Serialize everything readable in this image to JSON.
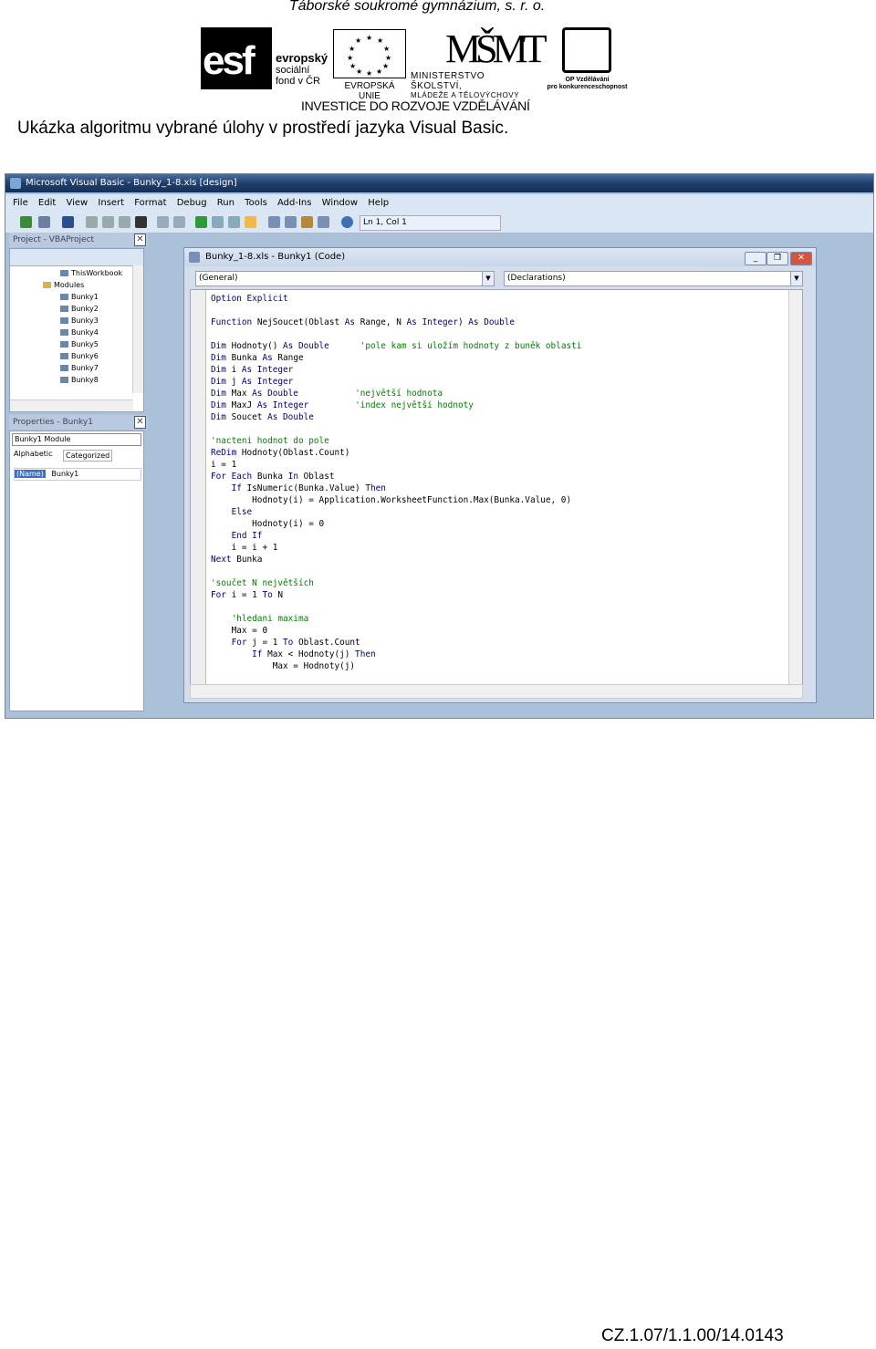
{
  "header": {
    "school": "Táborské soukromé gymnázium, s. r. o.",
    "logos": {
      "esf_letters": "esf",
      "esf_line1": "evropský",
      "esf_line2": "sociální",
      "esf_line3": "fond v ČR",
      "eu": "EVROPSKÁ UNIE",
      "msmt_mark": "MŠMT",
      "msmt_line1": "MINISTERSTVO ŠKOLSTVÍ,",
      "msmt_line2": "MLÁDEŽE A TĚLOVÝCHOVY",
      "op_line1": "OP Vzdělávání",
      "op_line2": "pro konkurenceschopnost",
      "invest": "INVESTICE DO ROZVOJE VZDĚLÁVÁNÍ"
    },
    "heading": "Ukázka algoritmu vybrané úlohy v prostředí jazyka Visual Basic."
  },
  "vbe": {
    "title": "Microsoft Visual Basic - Bunky_1-8.xls [design]",
    "menu": [
      "File",
      "Edit",
      "View",
      "Insert",
      "Format",
      "Debug",
      "Run",
      "Tools",
      "Add-Ins",
      "Window",
      "Help"
    ],
    "position": "Ln 1, Col 1",
    "project_title": "Project - VBAProject",
    "tree": [
      "ThisWorkbook",
      "Modules",
      "Bunky1",
      "Bunky2",
      "Bunky3",
      "Bunky4",
      "Bunky5",
      "Bunky6",
      "Bunky7",
      "Bunky8"
    ],
    "props_title": "Properties - Bunky1",
    "props_combo": "Bunky1 Module",
    "props_tabs": [
      "Alphabetic",
      "Categorized"
    ],
    "props_name_key": "(Name)",
    "props_name_val": "Bunky1",
    "close_glyph": "✕",
    "code_title": "Bunky_1-8.xls - Bunky1 (Code)",
    "combo_left": "(General)",
    "combo_right": "(Declarations)",
    "code_lines": [
      {
        "parts": [
          {
            "t": "Option Explicit",
            "c": "kw"
          }
        ]
      },
      {
        "parts": []
      },
      {
        "parts": [
          {
            "t": "Function ",
            "c": "kw"
          },
          {
            "t": "NejSoucet(Oblast ",
            "c": "tx"
          },
          {
            "t": "As ",
            "c": "kw"
          },
          {
            "t": "Range, N ",
            "c": "tx"
          },
          {
            "t": "As Integer",
            "c": "kw"
          },
          {
            "t": ") ",
            "c": "tx"
          },
          {
            "t": "As Double",
            "c": "kw"
          }
        ]
      },
      {
        "parts": []
      },
      {
        "parts": [
          {
            "t": "Dim ",
            "c": "kw"
          },
          {
            "t": "Hodnoty() ",
            "c": "tx"
          },
          {
            "t": "As Double",
            "c": "kw"
          },
          {
            "t": "      ",
            "c": "tx"
          },
          {
            "t": "'pole kam si uložím hodnoty z buněk oblasti",
            "c": "cm"
          }
        ]
      },
      {
        "parts": [
          {
            "t": "Dim ",
            "c": "kw"
          },
          {
            "t": "Bunka ",
            "c": "tx"
          },
          {
            "t": "As ",
            "c": "kw"
          },
          {
            "t": "Range",
            "c": "tx"
          }
        ]
      },
      {
        "parts": [
          {
            "t": "Dim ",
            "c": "kw"
          },
          {
            "t": "i ",
            "c": "tx"
          },
          {
            "t": "As Integer",
            "c": "kw"
          }
        ]
      },
      {
        "parts": [
          {
            "t": "Dim ",
            "c": "kw"
          },
          {
            "t": "j ",
            "c": "tx"
          },
          {
            "t": "As Integer",
            "c": "kw"
          }
        ]
      },
      {
        "parts": [
          {
            "t": "Dim ",
            "c": "kw"
          },
          {
            "t": "Max ",
            "c": "tx"
          },
          {
            "t": "As Double",
            "c": "kw"
          },
          {
            "t": "           ",
            "c": "tx"
          },
          {
            "t": "'největší hodnota",
            "c": "cm"
          }
        ]
      },
      {
        "parts": [
          {
            "t": "Dim ",
            "c": "kw"
          },
          {
            "t": "MaxJ ",
            "c": "tx"
          },
          {
            "t": "As Integer",
            "c": "kw"
          },
          {
            "t": "         ",
            "c": "tx"
          },
          {
            "t": "'index největší hodnoty",
            "c": "cm"
          }
        ]
      },
      {
        "parts": [
          {
            "t": "Dim ",
            "c": "kw"
          },
          {
            "t": "Soucet ",
            "c": "tx"
          },
          {
            "t": "As Double",
            "c": "kw"
          }
        ]
      },
      {
        "parts": []
      },
      {
        "parts": [
          {
            "t": "'nacteni hodnot do pole",
            "c": "cm"
          }
        ]
      },
      {
        "parts": [
          {
            "t": "ReDim ",
            "c": "kw"
          },
          {
            "t": "Hodnoty(Oblast.Count)",
            "c": "tx"
          }
        ]
      },
      {
        "parts": [
          {
            "t": "i = 1",
            "c": "tx"
          }
        ]
      },
      {
        "parts": [
          {
            "t": "For Each ",
            "c": "kw"
          },
          {
            "t": "Bunka ",
            "c": "tx"
          },
          {
            "t": "In ",
            "c": "kw"
          },
          {
            "t": "Oblast",
            "c": "tx"
          }
        ]
      },
      {
        "parts": [
          {
            "t": "    If ",
            "c": "kw"
          },
          {
            "t": "IsNumeric(Bunka.Value) ",
            "c": "tx"
          },
          {
            "t": "Then",
            "c": "kw"
          }
        ]
      },
      {
        "parts": [
          {
            "t": "        Hodnoty(i) = Application.WorksheetFunction.Max(Bunka.Value, 0)",
            "c": "tx"
          }
        ]
      },
      {
        "parts": [
          {
            "t": "    Else",
            "c": "kw"
          }
        ]
      },
      {
        "parts": [
          {
            "t": "        Hodnoty(i) = 0",
            "c": "tx"
          }
        ]
      },
      {
        "parts": [
          {
            "t": "    End If",
            "c": "kw"
          }
        ]
      },
      {
        "parts": [
          {
            "t": "    i = i + 1",
            "c": "tx"
          }
        ]
      },
      {
        "parts": [
          {
            "t": "Next ",
            "c": "kw"
          },
          {
            "t": "Bunka",
            "c": "tx"
          }
        ]
      },
      {
        "parts": []
      },
      {
        "parts": [
          {
            "t": "'součet N největších",
            "c": "cm"
          }
        ]
      },
      {
        "parts": [
          {
            "t": "For ",
            "c": "kw"
          },
          {
            "t": "i = 1 ",
            "c": "tx"
          },
          {
            "t": "To ",
            "c": "kw"
          },
          {
            "t": "N",
            "c": "tx"
          }
        ]
      },
      {
        "parts": []
      },
      {
        "parts": [
          {
            "t": "    'hledani maxima",
            "c": "cm"
          }
        ]
      },
      {
        "parts": [
          {
            "t": "    Max = 0",
            "c": "tx"
          }
        ]
      },
      {
        "parts": [
          {
            "t": "    For ",
            "c": "kw"
          },
          {
            "t": "j = 1 ",
            "c": "tx"
          },
          {
            "t": "To ",
            "c": "kw"
          },
          {
            "t": "Oblast.Count",
            "c": "tx"
          }
        ]
      },
      {
        "parts": [
          {
            "t": "        If ",
            "c": "kw"
          },
          {
            "t": "Max < Hodnoty(j) ",
            "c": "tx"
          },
          {
            "t": "Then",
            "c": "kw"
          }
        ]
      },
      {
        "parts": [
          {
            "t": "            Max = Hodnoty(j)",
            "c": "tx"
          }
        ]
      }
    ]
  },
  "footer": "CZ.1.07/1.1.00/14.0143"
}
